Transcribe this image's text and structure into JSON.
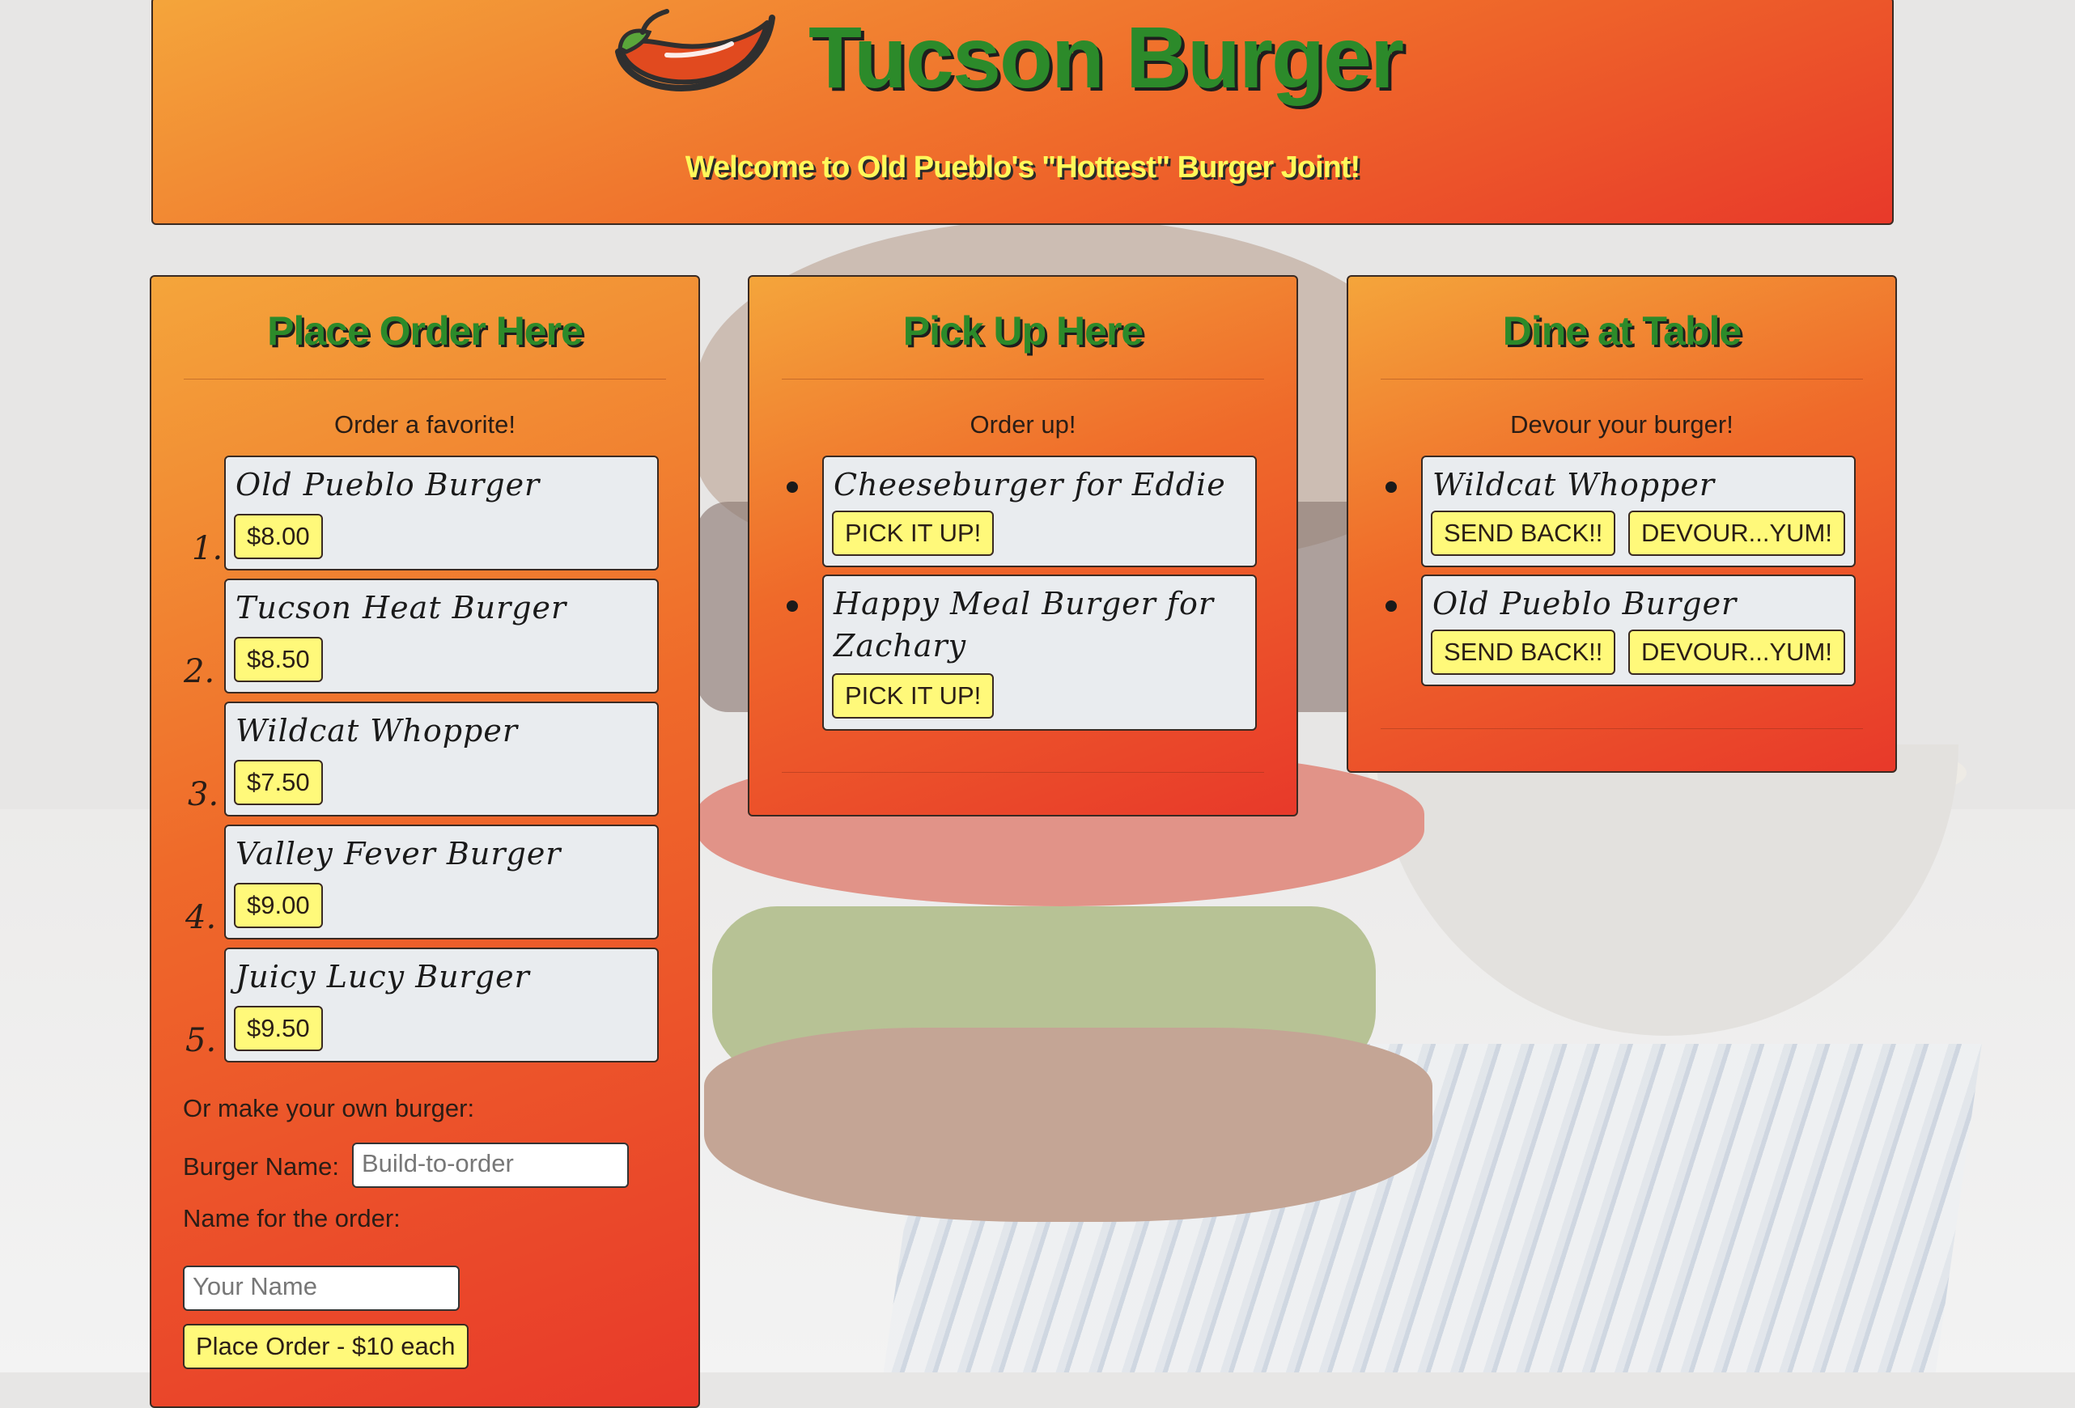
{
  "header": {
    "title": "Tucson Burger",
    "tagline": "Welcome to Old Pueblo's \"Hottest\" Burger Joint!",
    "logo_icon": "chili-pepper-icon"
  },
  "colors": {
    "panel_gradient_start": "#f4a53b",
    "panel_gradient_end": "#e8392a",
    "title_green": "#2c8a2a",
    "button_yellow": "#fff97a",
    "tagline_yellow": "#fff95a"
  },
  "order": {
    "title": "Place Order Here",
    "subhead": "Order a favorite!",
    "favorites": [
      {
        "number": "1.",
        "name": "Old Pueblo Burger",
        "price": "$8.00"
      },
      {
        "number": "2.",
        "name": "Tucson Heat Burger",
        "price": "$8.50"
      },
      {
        "number": "3.",
        "name": "Wildcat Whopper",
        "price": "$7.50"
      },
      {
        "number": "4.",
        "name": "Valley Fever Burger",
        "price": "$9.00"
      },
      {
        "number": "5.",
        "name": "Juicy Lucy Burger",
        "price": "$9.50"
      }
    ],
    "custom_heading": "Or make your own burger:",
    "burger_name_label": "Burger Name:",
    "burger_name_placeholder": "Build-to-order",
    "order_name_label": "Name for the order:",
    "order_name_placeholder": "Your Name",
    "submit_label": "Place Order - $10 each"
  },
  "pickup": {
    "title": "Pick Up Here",
    "subhead": "Order up!",
    "items": [
      {
        "name": "Cheeseburger for Eddie",
        "button": "PICK IT UP!"
      },
      {
        "name_line1": "Happy Meal Burger for",
        "name_line2": "Zachary",
        "button": "PICK IT UP!"
      }
    ]
  },
  "dine": {
    "title": "Dine at Table",
    "subhead": "Devour your burger!",
    "items": [
      {
        "name": "Wildcat Whopper",
        "send_back": "SEND BACK!!",
        "devour": "DEVOUR...YUM!"
      },
      {
        "name": "Old Pueblo Burger",
        "send_back": "SEND BACK!!",
        "devour": "DEVOUR...YUM!"
      }
    ]
  }
}
